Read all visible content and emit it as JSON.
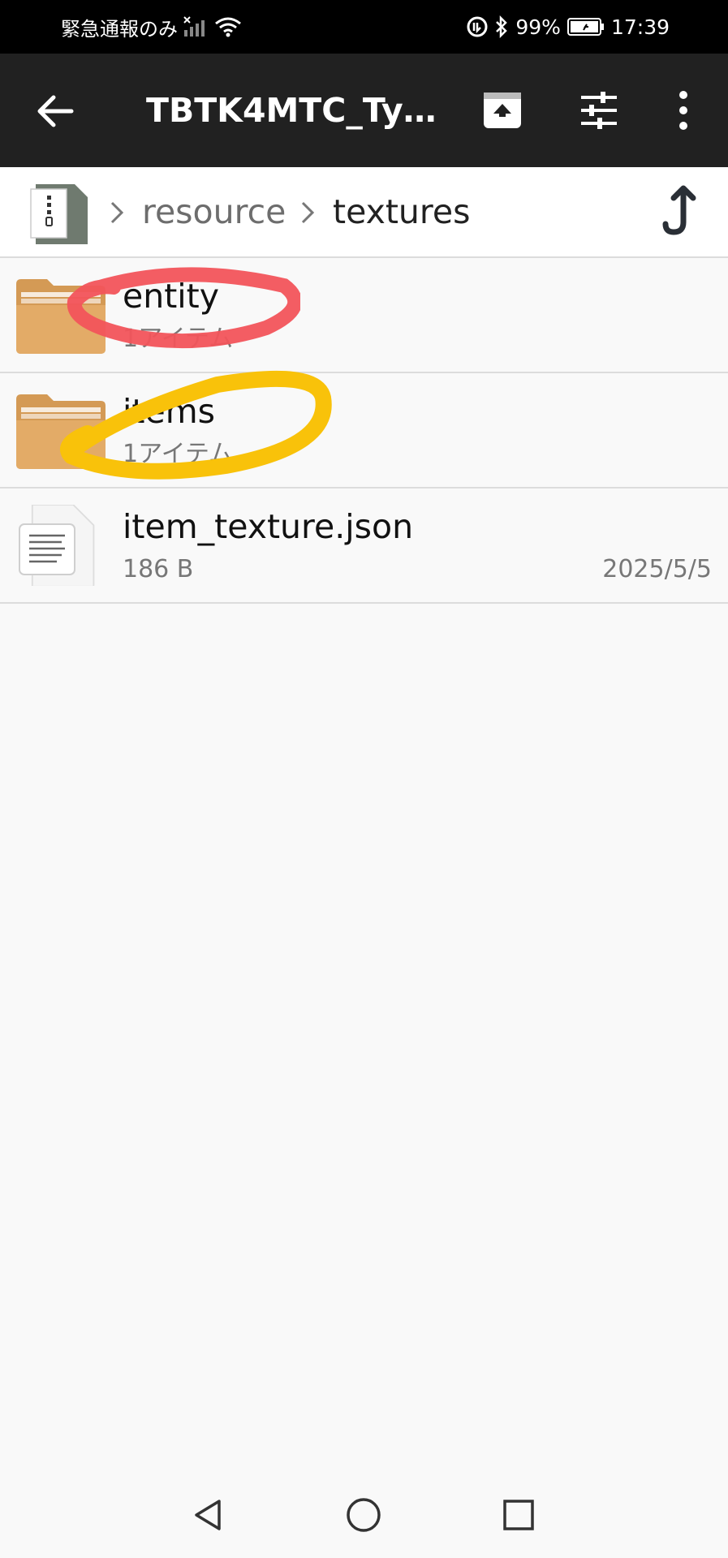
{
  "status_bar": {
    "carrier": "緊急通報のみ",
    "battery": "99%",
    "time": "17:39",
    "icons": [
      "signal-icon",
      "wifi-icon",
      "nfc-icon",
      "bluetooth-icon",
      "battery-icon"
    ]
  },
  "app_bar": {
    "title": "TBTK4MTC_Typ...",
    "actions": [
      "back-arrow-icon",
      "upload-icon",
      "filter-sliders-icon",
      "more-vert-icon"
    ]
  },
  "breadcrumb": {
    "root_icon": "zip-archive-icon",
    "items": [
      "resource",
      "textures"
    ],
    "up_icon": "go-up-icon"
  },
  "files": [
    {
      "name": "entity",
      "meta": "1アイテム",
      "date": "",
      "type": "folder",
      "annotation": "red-circle"
    },
    {
      "name": "items",
      "meta": "1アイテム",
      "date": "",
      "type": "folder",
      "annotation": "yellow-circle"
    },
    {
      "name": "item_texture.json",
      "meta": "186 B",
      "date": "2025/5/5",
      "type": "file",
      "annotation": ""
    }
  ],
  "colors": {
    "app_bar": "#212121",
    "folder": "#e3ab67",
    "annotation_red": "#f2545b",
    "annotation_yellow": "#f9c20a"
  },
  "nav_bar": [
    "back-triangle-icon",
    "home-circle-icon",
    "recents-square-icon"
  ]
}
